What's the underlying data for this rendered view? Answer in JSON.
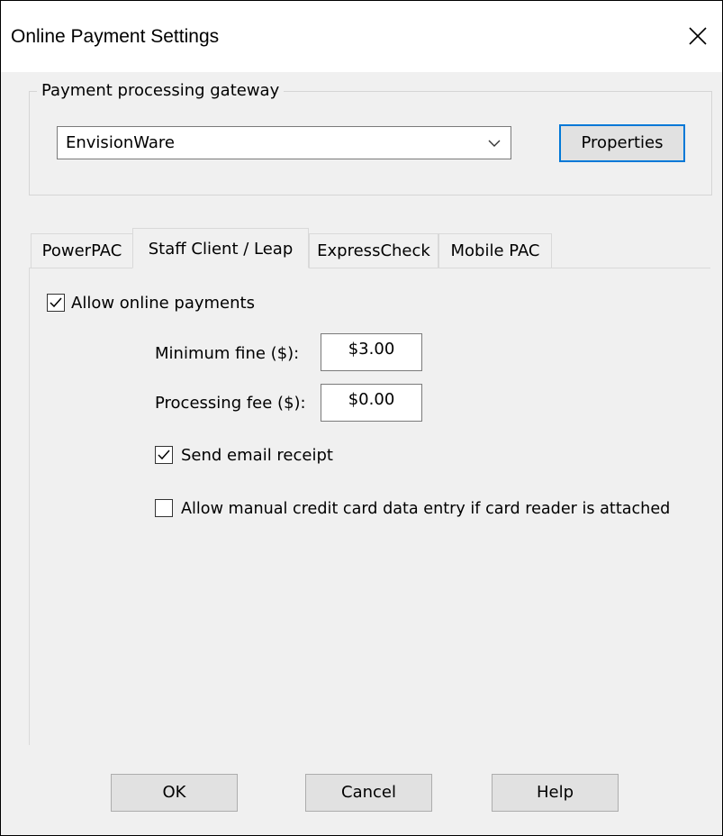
{
  "window": {
    "title": "Online Payment Settings",
    "close_icon": "close-icon"
  },
  "gateway": {
    "legend": "Payment processing gateway",
    "selected": "EnvisionWare",
    "properties_label": "Properties"
  },
  "tabs": [
    {
      "label": "PowerPAC",
      "active": false
    },
    {
      "label": "Staff Client / Leap",
      "active": true
    },
    {
      "label": "ExpressCheck",
      "active": false
    },
    {
      "label": "Mobile PAC",
      "active": false
    }
  ],
  "panel": {
    "allow_online_payments": {
      "label": "Allow online payments",
      "checked": true
    },
    "minimum_fine": {
      "label": "Minimum fine ($):",
      "value": "$3.00"
    },
    "processing_fee": {
      "label": "Processing fee ($):",
      "value": "$0.00"
    },
    "send_email_receipt": {
      "label": "Send email receipt",
      "checked": true
    },
    "allow_manual_entry": {
      "label": "Allow manual credit card data entry if card reader is attached",
      "checked": false
    }
  },
  "footer": {
    "ok": "OK",
    "cancel": "Cancel",
    "help": "Help"
  }
}
